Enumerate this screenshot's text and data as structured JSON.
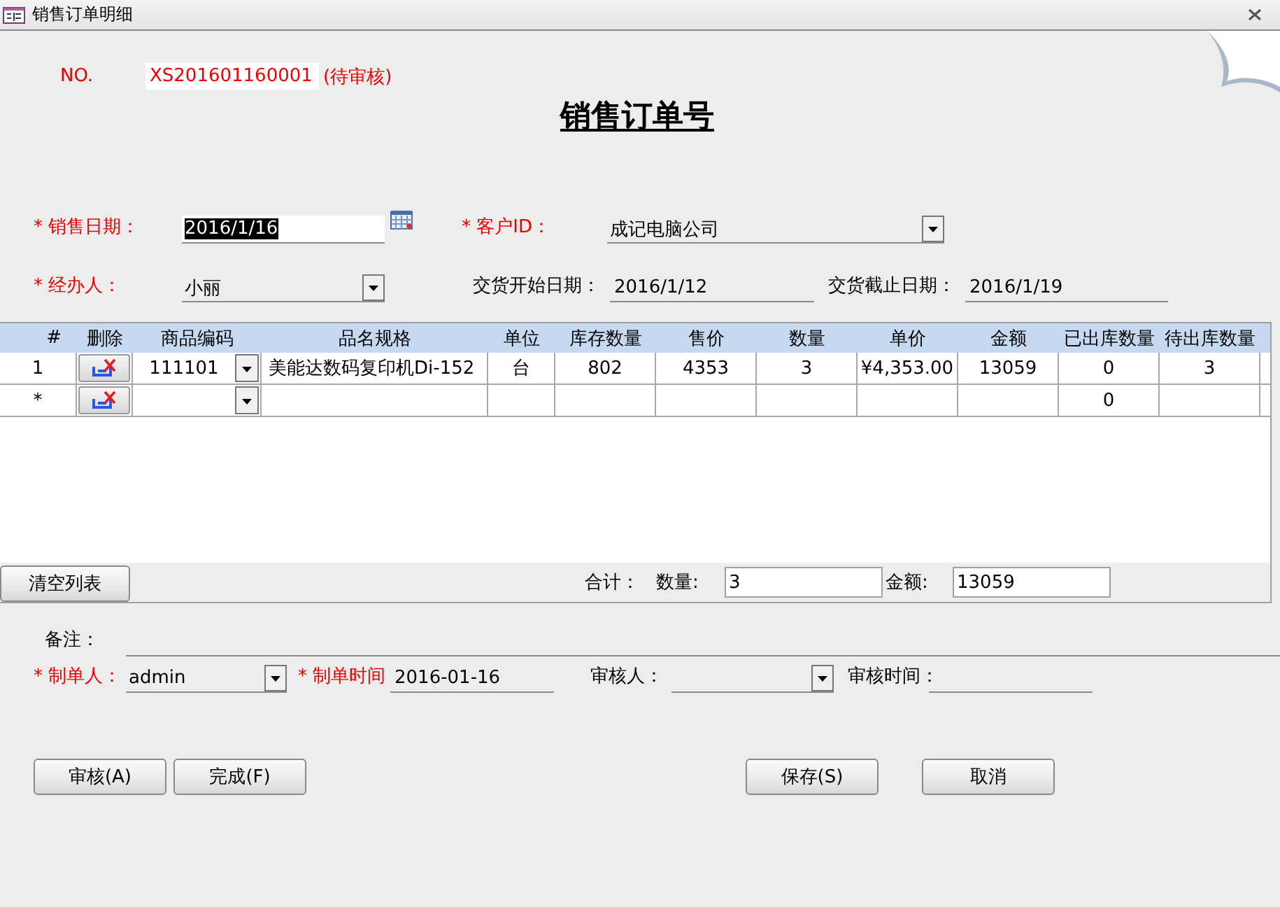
{
  "window": {
    "title": "销售订单明细"
  },
  "order": {
    "no_label": "NO.",
    "number": "XS201601160001",
    "status": "(待审核)"
  },
  "heading": "销售订单号",
  "field_rows": [
    [
      {
        "kind": "date",
        "label": "* 销售日期：",
        "required": true,
        "value": "2016/1/16",
        "selected": true
      },
      {
        "kind": "combo",
        "label": "* 客户ID：",
        "required": true,
        "value": "成记电脑公司"
      }
    ],
    [
      {
        "kind": "combo",
        "label": "* 经办人：",
        "required": true,
        "value": "小丽"
      },
      {
        "kind": "text",
        "label": "交货开始日期：",
        "required": false,
        "value": "2016/1/12"
      },
      {
        "kind": "text",
        "label": "交货截止日期：",
        "required": false,
        "value": "2016/1/19"
      }
    ]
  ],
  "table": {
    "columns": [
      "#",
      "删除",
      "商品编码",
      "品名规格",
      "单位",
      "库存数量",
      "售价",
      "数量",
      "单价",
      "金额",
      "已出库数量",
      "待出库数量"
    ],
    "rows": [
      {
        "marker": "1",
        "code": "111101",
        "name": "美能达数码复印机Di-152",
        "unit": "台",
        "stock": "802",
        "price": "4353",
        "qty": "3",
        "unit_price": "¥4,353.00",
        "amount": "13059",
        "shipped": "0",
        "pending": "3"
      },
      {
        "marker": "*",
        "shipped": "0"
      }
    ]
  },
  "totals": {
    "clear_button": "清空列表",
    "label": "合计：",
    "qty_label": "数量:",
    "qty": "3",
    "amount_label": "金额:",
    "amount": "13059"
  },
  "remark": {
    "label": "备注："
  },
  "footer_fields": [
    {
      "kind": "combo",
      "label": "* 制单人：",
      "required": true,
      "value": "admin"
    },
    {
      "kind": "text",
      "label": "* 制单时间",
      "required": true,
      "value": "2016-01-16"
    },
    {
      "kind": "combo",
      "label": "审核人：",
      "required": false
    },
    {
      "kind": "text",
      "label": "审核时间：",
      "required": false
    }
  ],
  "buttons": [
    "审核(A)",
    "完成(F)",
    "保存(S)",
    "取消"
  ]
}
